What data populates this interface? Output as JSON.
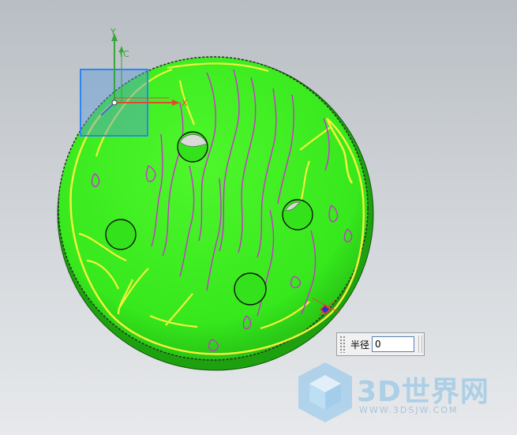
{
  "axis": {
    "y_label": "Y",
    "yc_label": "YC",
    "x_label": "X"
  },
  "radius_field": {
    "label": "半径",
    "value": "0"
  },
  "watermark": {
    "title": "3D世界网",
    "url": "WWW.3DSJW.COM"
  },
  "colors": {
    "part_surface": "#3df11f",
    "contour_yellow": "#f4f13b",
    "contour_magenta": "#cc2fd2",
    "axis_red": "#e04b2b",
    "axis_green": "#3aa33a",
    "selection_blue": "#2f84ee"
  }
}
